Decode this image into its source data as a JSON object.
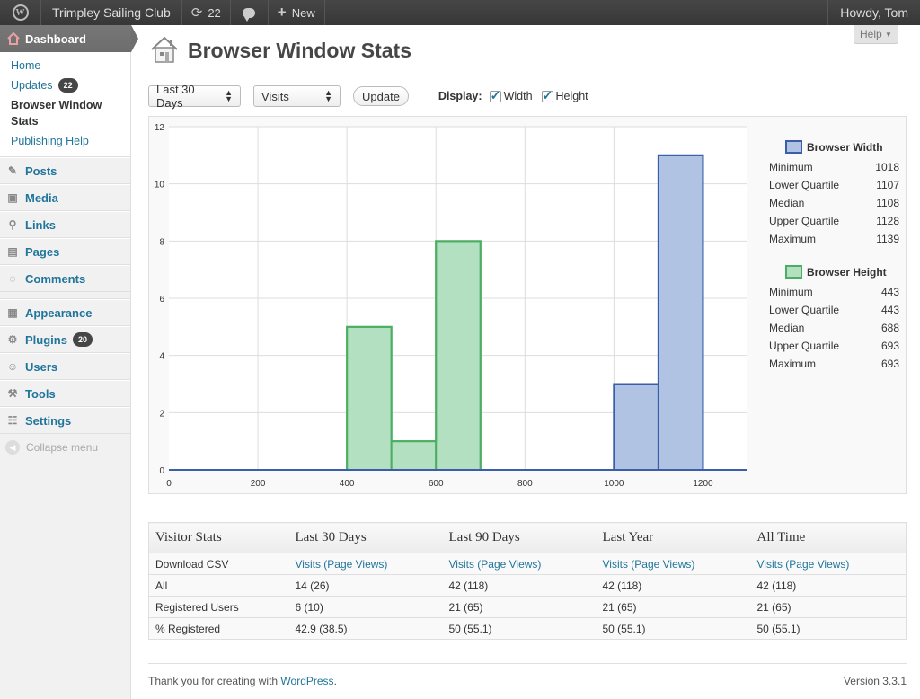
{
  "adminbar": {
    "wp_logo": "wordpress-logo-icon",
    "site_name": "Trimpley Sailing Club",
    "updates_count": "22",
    "new_label": "New",
    "howdy": "Howdy, Tom"
  },
  "sidebar": {
    "dashboard_label": "Dashboard",
    "submenu": {
      "home": "Home",
      "updates": "Updates",
      "updates_count": "22",
      "browser_stats": "Browser Window Stats",
      "publishing_help": "Publishing Help"
    },
    "items": [
      {
        "label": "Posts",
        "icon": "pushpin-icon"
      },
      {
        "label": "Media",
        "icon": "media-icon"
      },
      {
        "label": "Links",
        "icon": "link-icon"
      },
      {
        "label": "Pages",
        "icon": "pages-icon"
      },
      {
        "label": "Comments",
        "icon": "comment-icon"
      },
      {
        "label": "Appearance",
        "icon": "appearance-icon"
      },
      {
        "label": "Plugins",
        "icon": "plugin-icon",
        "count": "20"
      },
      {
        "label": "Users",
        "icon": "users-icon"
      },
      {
        "label": "Tools",
        "icon": "tools-icon"
      },
      {
        "label": "Settings",
        "icon": "settings-icon"
      }
    ],
    "collapse_label": "Collapse menu"
  },
  "header": {
    "help_label": "Help",
    "title": "Browser Window Stats"
  },
  "controls": {
    "period_value": "Last 30 Days",
    "metric_value": "Visits",
    "update_label": "Update",
    "display_label": "Display:",
    "width_label": "Width",
    "height_label": "Height"
  },
  "colors": {
    "width_fill": "#b0c3e2",
    "width_stroke": "#3a5ea9",
    "height_fill": "#b4e0c2",
    "height_stroke": "#4cae62"
  },
  "chart_data": {
    "type": "bar",
    "xlim": [
      0,
      1300
    ],
    "ylim": [
      0,
      12
    ],
    "xticks": [
      0,
      200,
      400,
      600,
      800,
      1000,
      1200
    ],
    "yticks": [
      0,
      2,
      4,
      6,
      8,
      10,
      12
    ],
    "bin_width": 100,
    "grid": true,
    "series": [
      {
        "name": "Browser Height",
        "bins": [
          {
            "x": 400,
            "value": 5
          },
          {
            "x": 500,
            "value": 1
          },
          {
            "x": 600,
            "value": 8
          }
        ]
      },
      {
        "name": "Browser Width",
        "bins": [
          {
            "x": 1000,
            "value": 3
          },
          {
            "x": 1100,
            "value": 11
          }
        ]
      }
    ]
  },
  "legend": {
    "width": {
      "title": "Browser Width",
      "rows": [
        {
          "label": "Minimum",
          "value": "1018"
        },
        {
          "label": "Lower Quartile",
          "value": "1107"
        },
        {
          "label": "Median",
          "value": "1108"
        },
        {
          "label": "Upper Quartile",
          "value": "1128"
        },
        {
          "label": "Maximum",
          "value": "1139"
        }
      ]
    },
    "height": {
      "title": "Browser Height",
      "rows": [
        {
          "label": "Minimum",
          "value": "443"
        },
        {
          "label": "Lower Quartile",
          "value": "443"
        },
        {
          "label": "Median",
          "value": "688"
        },
        {
          "label": "Upper Quartile",
          "value": "693"
        },
        {
          "label": "Maximum",
          "value": "693"
        }
      ]
    }
  },
  "stats_table": {
    "headers": [
      "Visitor Stats",
      "Last 30 Days",
      "Last 90 Days",
      "Last Year",
      "All Time"
    ],
    "csv_row": {
      "label": "Download CSV",
      "link": "Visits (Page Views)"
    },
    "rows": [
      {
        "label": "All",
        "values": [
          "14 (26)",
          "42 (118)",
          "42 (118)",
          "42 (118)"
        ]
      },
      {
        "label": "Registered Users",
        "values": [
          "6 (10)",
          "21 (65)",
          "21 (65)",
          "21 (65)"
        ]
      },
      {
        "label": "% Registered",
        "values": [
          "42.9 (38.5)",
          "50 (55.1)",
          "50 (55.1)",
          "50 (55.1)"
        ]
      }
    ]
  },
  "footer": {
    "thanks_prefix": "Thank you for creating with",
    "wp_link": "WordPress",
    "thanks_suffix": ".",
    "version": "Version 3.3.1"
  }
}
